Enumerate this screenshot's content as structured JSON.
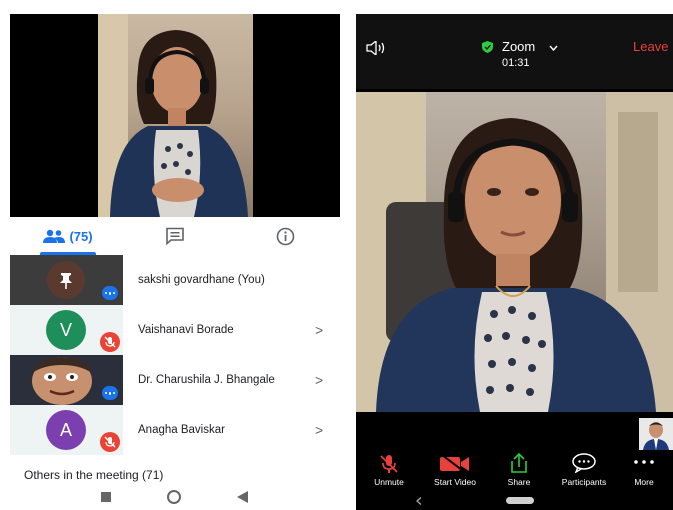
{
  "meet": {
    "tabs": {
      "people_count": "(75)"
    },
    "participants": [
      {
        "name": "sakshi govardhane (You)",
        "initial": ""
      },
      {
        "name": "Vaishanavi Borade",
        "initial": "V",
        "chevron": ">"
      },
      {
        "name": "Dr. Charushila J. Bhangale",
        "initial": "",
        "chevron": ">"
      },
      {
        "name": "Anagha Baviskar",
        "initial": "A",
        "chevron": ">"
      }
    ],
    "others_label": "Others in the meeting (71)",
    "colors": {
      "accent": "#1a73e8",
      "you_avatar": "#5a3a2e",
      "v_avatar": "#1e8e5a",
      "a_avatar": "#7b3fb0",
      "mute": "#ea4335"
    }
  },
  "zoom": {
    "title": "Zoom",
    "timer": "01:31",
    "leave_label": "Leave",
    "toolbar": {
      "unmute": "Unmute",
      "start_video": "Start Video",
      "share": "Share",
      "participants": "Participants",
      "more": "More"
    },
    "colors": {
      "leave": "#e8413c",
      "shield": "#2ecc40",
      "share": "#2ecc40",
      "muted": "#e8413c"
    }
  },
  "icons": [
    "people-icon",
    "chat-icon",
    "info-icon",
    "pin-icon",
    "mic-off-icon",
    "chevron-right-icon",
    "speaker-icon",
    "shield-icon",
    "chevron-down-icon",
    "mic-off-icon",
    "video-off-icon",
    "share-icon",
    "chat-bubble-icon",
    "more-icon",
    "home-nav-icon",
    "back-nav-icon",
    "recents-nav-icon"
  ]
}
